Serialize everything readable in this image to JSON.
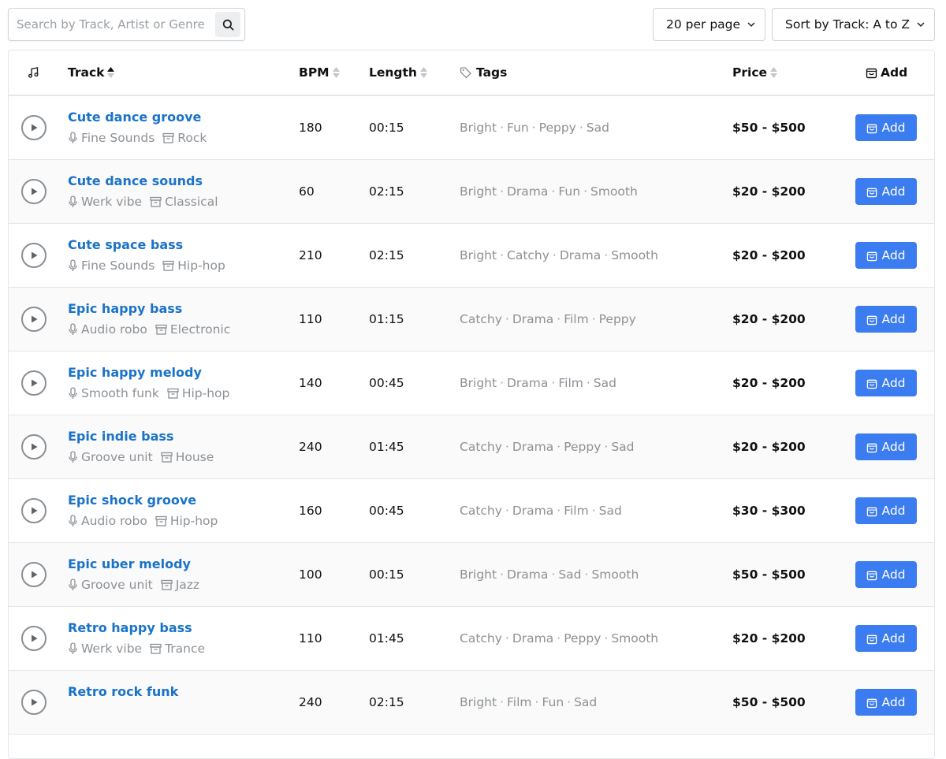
{
  "search": {
    "placeholder": "Search by Track, Artist or Genre",
    "value": "",
    "icon": "search-icon"
  },
  "per_page": {
    "label": "20 per page",
    "icon": "chevron-down-icon"
  },
  "sort": {
    "label": "Sort by Track: A to Z",
    "icon": "chevron-down-icon"
  },
  "table": {
    "headers": {
      "music_icon": "music-note-icon",
      "track": "Track",
      "bpm": "BPM",
      "length": "Length",
      "tags": "Tags",
      "tags_icon": "tag-icon",
      "price": "Price",
      "add": "Add",
      "add_icon": "shopping-bag-icon"
    },
    "active_sort": "track-ascending",
    "add_button_label": "Add",
    "rows": [
      {
        "title": "Cute dance groove",
        "artist": "Fine Sounds",
        "genre": "Rock",
        "bpm": "180",
        "length": "00:15",
        "tags": [
          "Bright",
          "Fun",
          "Peppy",
          "Sad"
        ],
        "price": "$50 - $500"
      },
      {
        "title": "Cute dance sounds",
        "artist": "Werk vibe",
        "genre": "Classical",
        "bpm": "60",
        "length": "02:15",
        "tags": [
          "Bright",
          "Drama",
          "Fun",
          "Smooth"
        ],
        "price": "$20 - $200"
      },
      {
        "title": "Cute space bass",
        "artist": "Fine Sounds",
        "genre": "Hip-hop",
        "bpm": "210",
        "length": "02:15",
        "tags": [
          "Bright",
          "Catchy",
          "Drama",
          "Smooth"
        ],
        "price": "$20 - $200"
      },
      {
        "title": "Epic happy bass",
        "artist": "Audio robo",
        "genre": "Electronic",
        "bpm": "110",
        "length": "01:15",
        "tags": [
          "Catchy",
          "Drama",
          "Film",
          "Peppy"
        ],
        "price": "$20 - $200"
      },
      {
        "title": "Epic happy melody",
        "artist": "Smooth funk",
        "genre": "Hip-hop",
        "bpm": "140",
        "length": "00:45",
        "tags": [
          "Bright",
          "Drama",
          "Film",
          "Sad"
        ],
        "price": "$20 - $200"
      },
      {
        "title": "Epic indie bass",
        "artist": "Groove unit",
        "genre": "House",
        "bpm": "240",
        "length": "01:45",
        "tags": [
          "Catchy",
          "Drama",
          "Peppy",
          "Sad"
        ],
        "price": "$20 - $200"
      },
      {
        "title": "Epic shock groove",
        "artist": "Audio robo",
        "genre": "Hip-hop",
        "bpm": "160",
        "length": "00:45",
        "tags": [
          "Catchy",
          "Drama",
          "Film",
          "Sad"
        ],
        "price": "$30 - $300"
      },
      {
        "title": "Epic uber melody",
        "artist": "Groove unit",
        "genre": "Jazz",
        "bpm": "100",
        "length": "00:15",
        "tags": [
          "Bright",
          "Drama",
          "Sad",
          "Smooth"
        ],
        "price": "$50 - $500"
      },
      {
        "title": "Retro happy bass",
        "artist": "Werk vibe",
        "genre": "Trance",
        "bpm": "110",
        "length": "01:45",
        "tags": [
          "Catchy",
          "Drama",
          "Peppy",
          "Smooth"
        ],
        "price": "$20 - $200"
      },
      {
        "title": "Retro rock funk",
        "artist": "",
        "genre": "",
        "bpm": "240",
        "length": "02:15",
        "tags": [
          "Bright",
          "Film",
          "Fun",
          "Sad"
        ],
        "price": "$50 - $500"
      }
    ]
  },
  "colors": {
    "link": "#1a73c8",
    "accent": "#3b7cf0",
    "muted": "#8c9196",
    "border": "#e3e6ea"
  }
}
